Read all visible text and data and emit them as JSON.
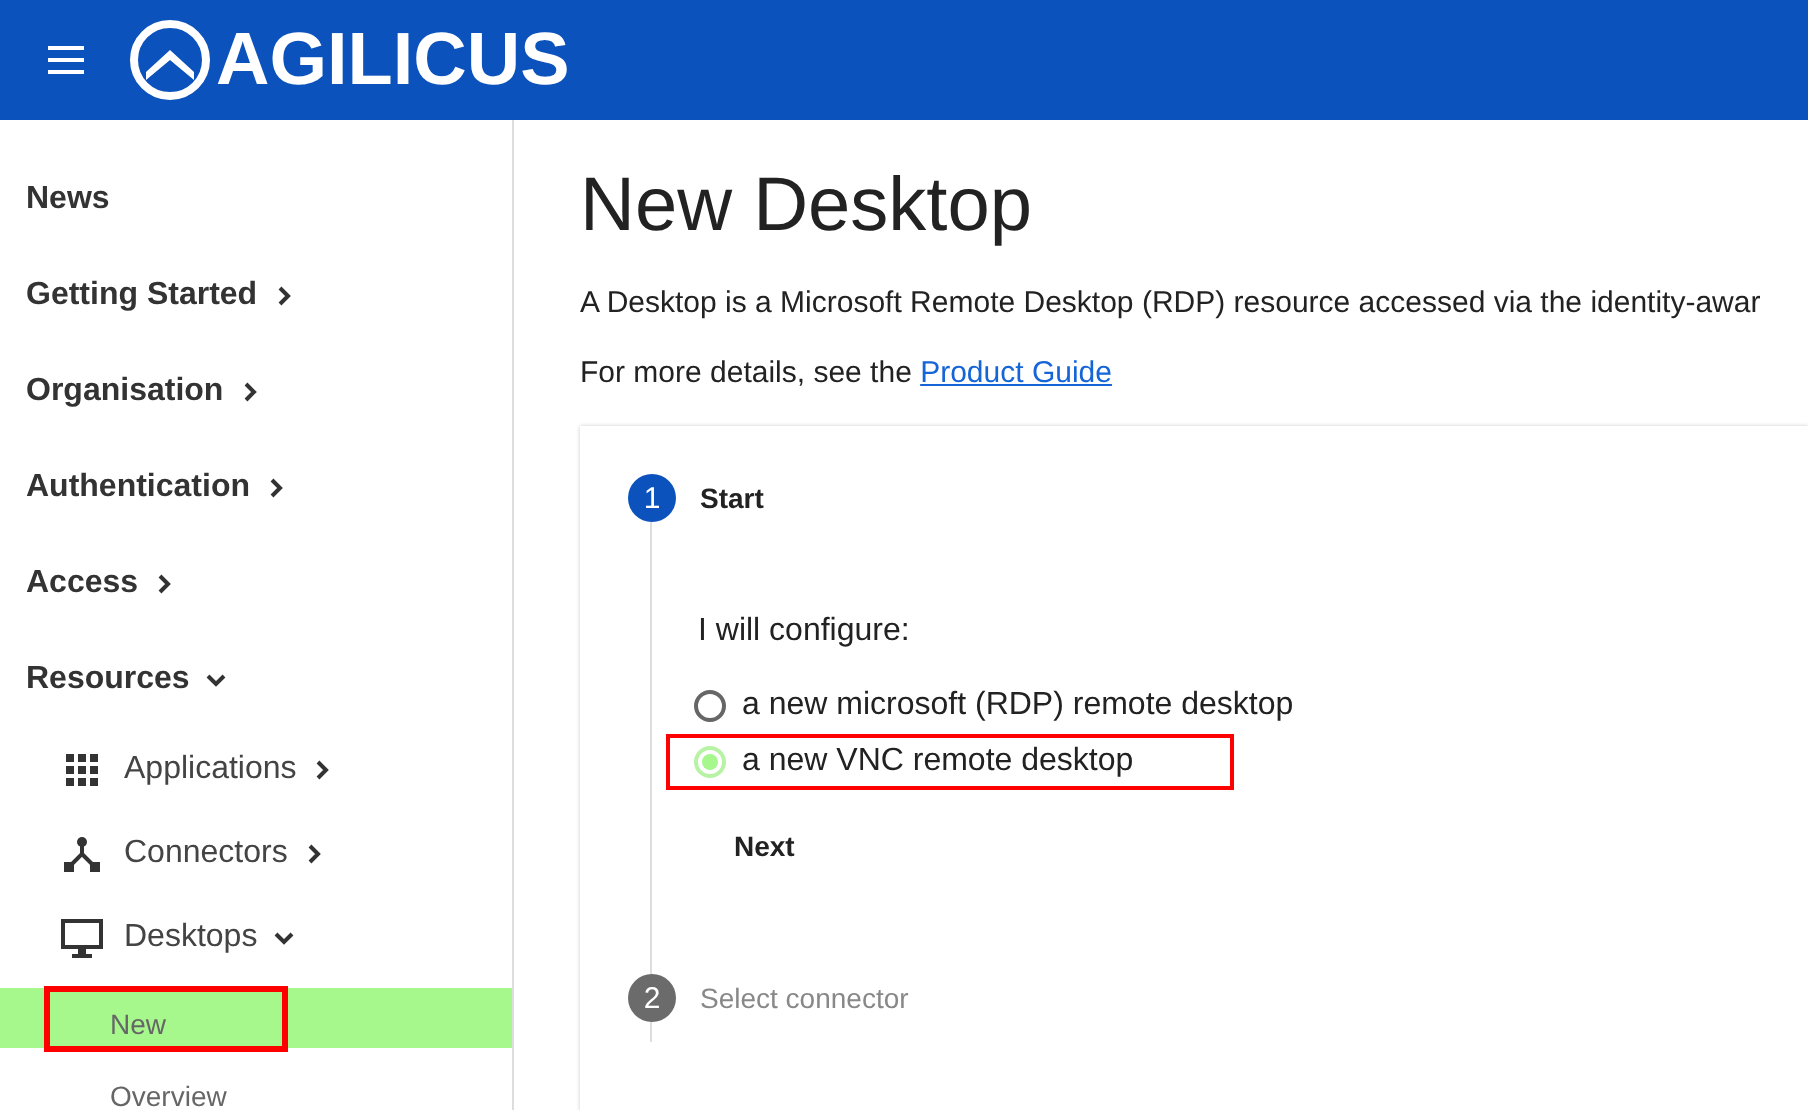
{
  "header": {
    "logo_text": "AGILICUS"
  },
  "sidebar": {
    "items": [
      {
        "label": "News",
        "has_arrow": false
      },
      {
        "label": "Getting Started",
        "has_arrow": true,
        "expanded": false
      },
      {
        "label": "Organisation",
        "has_arrow": true,
        "expanded": false
      },
      {
        "label": "Authentication",
        "has_arrow": true,
        "expanded": false
      },
      {
        "label": "Access",
        "has_arrow": true,
        "expanded": false
      },
      {
        "label": "Resources",
        "has_arrow": true,
        "expanded": true,
        "children": [
          {
            "label": "Applications",
            "expanded": false
          },
          {
            "label": "Connectors",
            "expanded": false
          },
          {
            "label": "Desktops",
            "expanded": true,
            "children": [
              {
                "label": "New",
                "selected": true,
                "highlighted": true
              },
              {
                "label": "Overview",
                "selected": false,
                "highlighted": false
              }
            ]
          }
        ]
      }
    ]
  },
  "main": {
    "title": "New Desktop",
    "description": "A Desktop is a Microsoft Remote Desktop (RDP) resource accessed via the identity-awar",
    "details_prefix": "For more details, see the ",
    "details_link": "Product Guide",
    "steps": [
      {
        "number": "1",
        "label": "Start",
        "active": true,
        "question": "I will configure:",
        "options": [
          {
            "label": "a new microsoft (RDP) remote desktop",
            "selected": false,
            "highlighted": false
          },
          {
            "label": "a new VNC remote desktop",
            "selected": true,
            "highlighted": true
          }
        ],
        "button": "Next"
      },
      {
        "number": "2",
        "label": "Select connector",
        "active": false
      }
    ]
  }
}
